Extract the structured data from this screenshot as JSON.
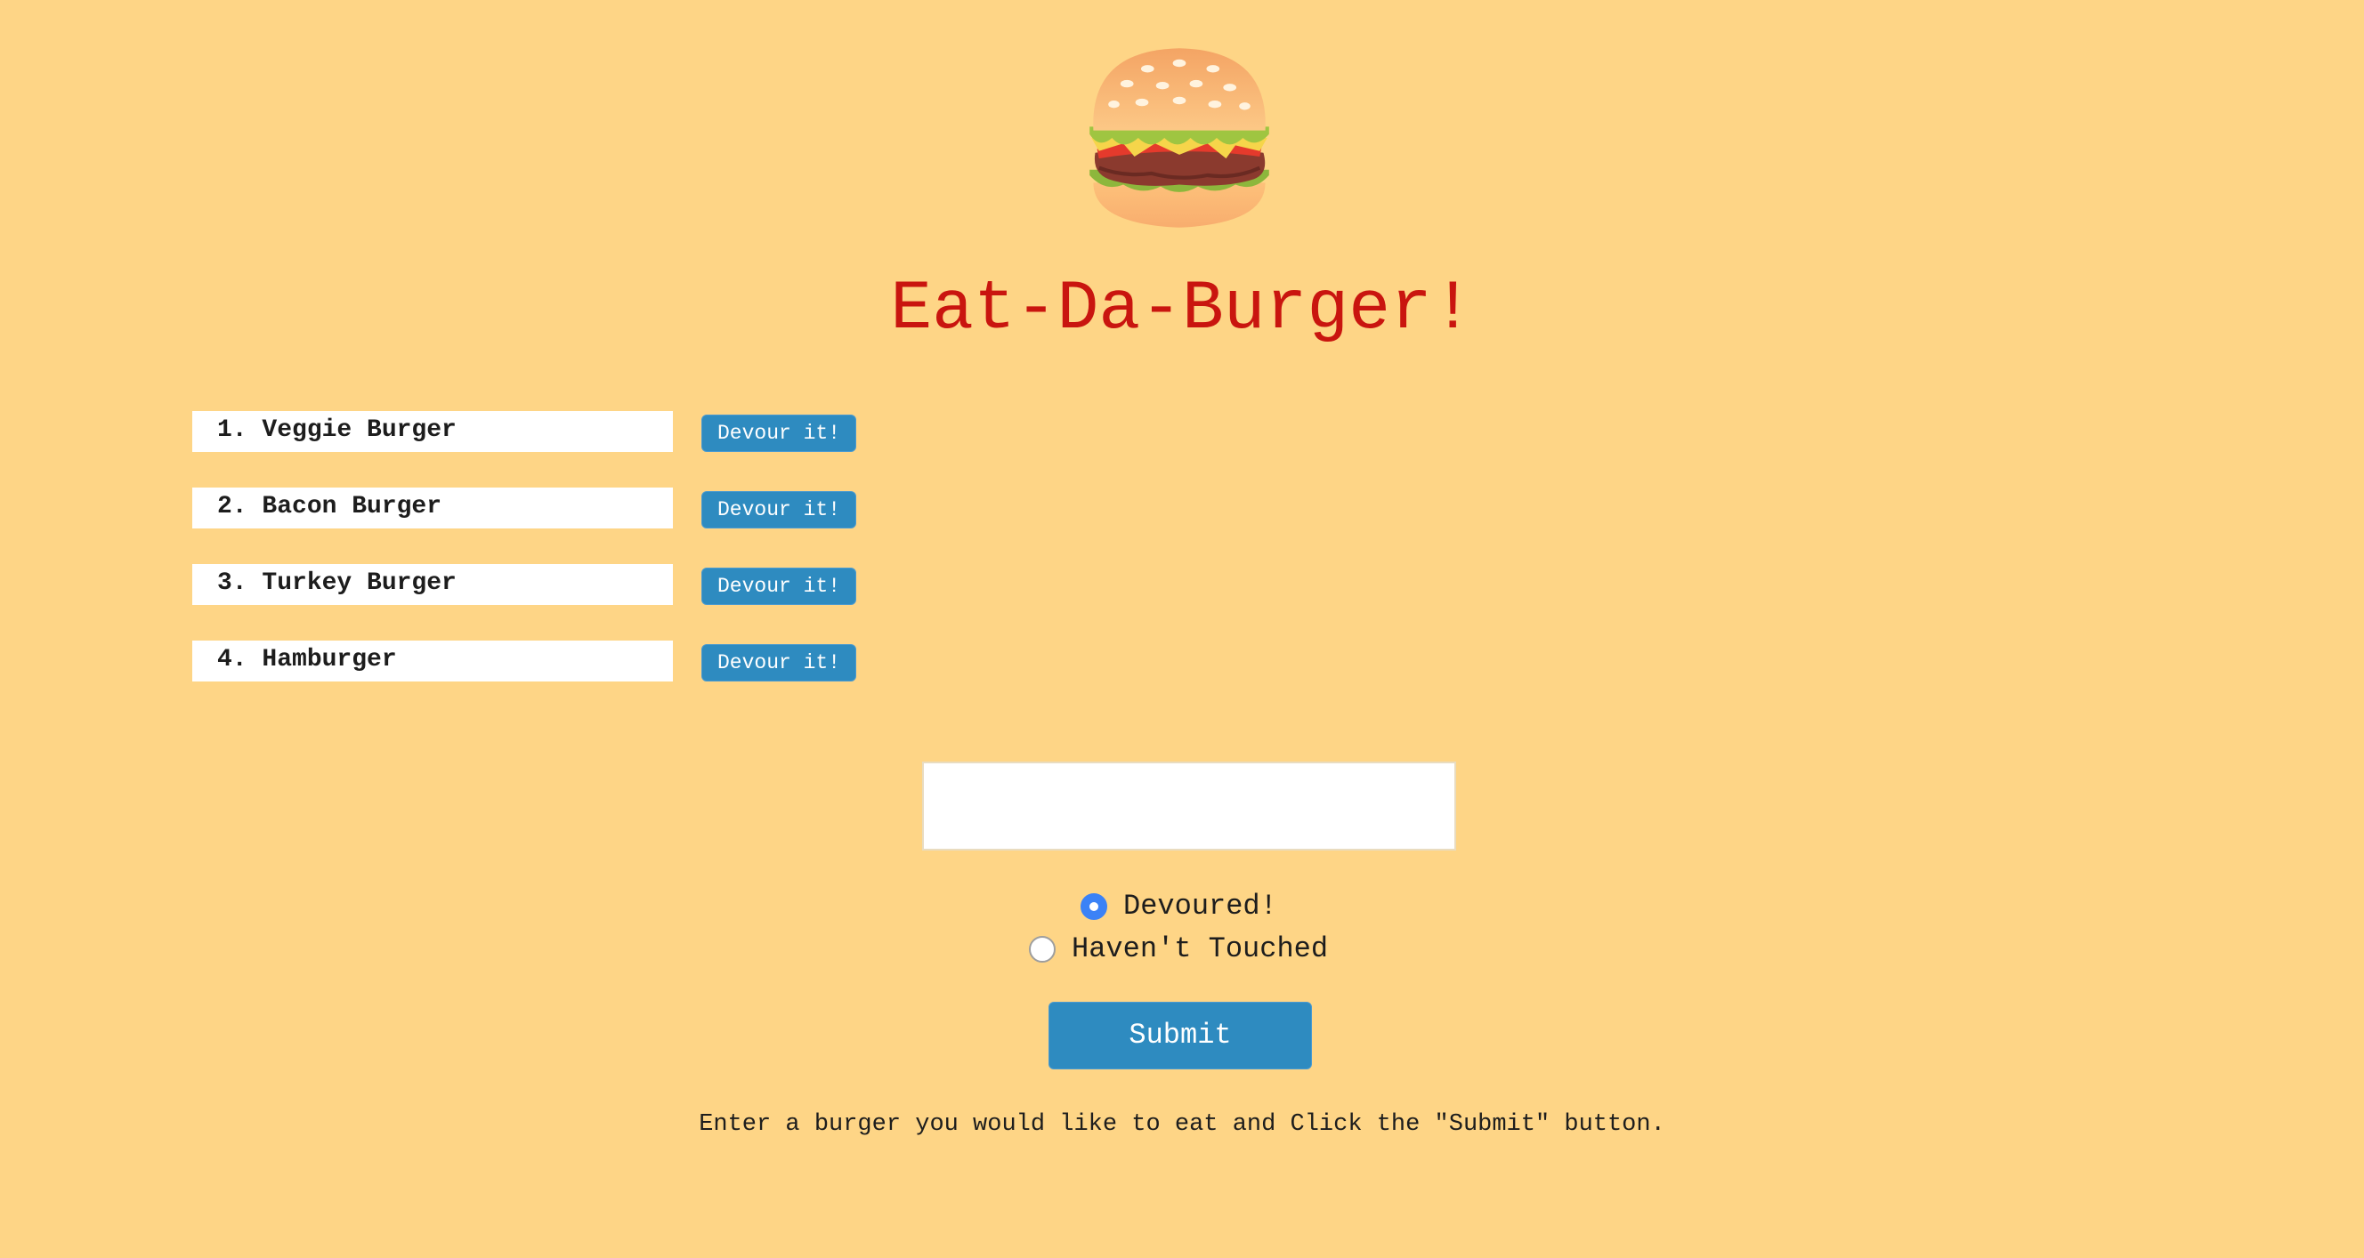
{
  "header": {
    "logo_icon": "burger-icon",
    "title": "Eat-Da-Burger!"
  },
  "burgers": [
    {
      "label": "1. Veggie Burger",
      "button": "Devour it!"
    },
    {
      "label": "2. Bacon Burger",
      "button": "Devour it!"
    },
    {
      "label": "3. Turkey Burger",
      "button": "Devour it!"
    },
    {
      "label": "4. Hamburger",
      "button": "Devour it!"
    }
  ],
  "form": {
    "input_value": "",
    "options": [
      {
        "label": "Devoured!",
        "checked": true
      },
      {
        "label": "Haven't Touched",
        "checked": false
      }
    ],
    "submit_label": "Submit",
    "instructions": "Enter a burger you would like to eat and Click the \"Submit\" button."
  },
  "colors": {
    "background": "#fed586",
    "title": "#c9150f",
    "button": "#2e8bc0",
    "radio_selected": "#3b82f6"
  }
}
